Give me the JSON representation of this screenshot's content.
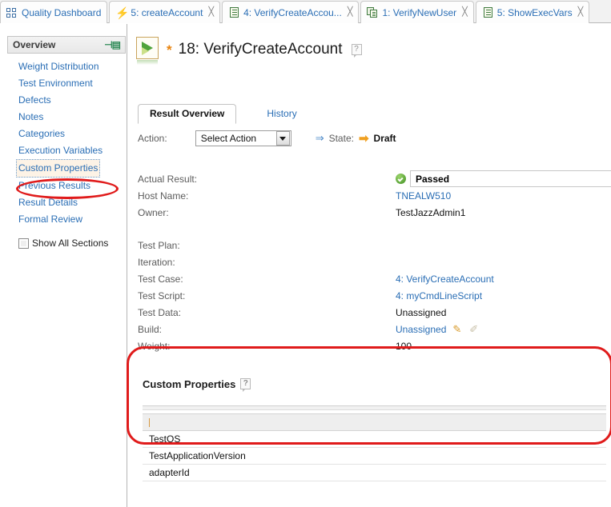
{
  "window": {
    "tabs": [
      {
        "label": "Quality Dashboard",
        "icon": "grid-icon",
        "closable": false
      },
      {
        "label": "5: createAccount",
        "icon": "lightning-icon",
        "closable": true
      },
      {
        "label": "4: VerifyCreateAccou...",
        "icon": "script-document-icon",
        "closable": true
      },
      {
        "label": "1: VerifyNewUser",
        "icon": "test-case-document-icon",
        "closable": true
      },
      {
        "label": "5: ShowExecVars",
        "icon": "script-document-icon",
        "closable": true
      }
    ],
    "close_glyph": "╳"
  },
  "sidebar": {
    "header": "Overview",
    "pin_glyph": "⊣▤",
    "items": [
      {
        "label": "Weight Distribution",
        "selected": false
      },
      {
        "label": "Test Environment",
        "selected": false
      },
      {
        "label": "Defects",
        "selected": false
      },
      {
        "label": "Notes",
        "selected": false
      },
      {
        "label": "Categories",
        "selected": false
      },
      {
        "label": "Execution Variables",
        "selected": false
      },
      {
        "label": "Custom Properties",
        "selected": true
      },
      {
        "label": "Previous Results",
        "selected": false
      },
      {
        "label": "Result Details",
        "selected": false
      },
      {
        "label": "Formal Review",
        "selected": false
      }
    ],
    "show_all_sections": {
      "label": "Show All Sections",
      "checked": false
    }
  },
  "page": {
    "dirty_marker": "*",
    "title": "18: VerifyCreateAccount",
    "help_glyph": "?",
    "icon": "run-test-icon"
  },
  "editor_tabs": [
    {
      "label": "Result Overview",
      "active": true
    },
    {
      "label": "History",
      "active": false
    }
  ],
  "action_bar": {
    "action_label": "Action:",
    "action_value": "Select Action",
    "state_label": "State:",
    "state_value": "Draft",
    "arrow_glyph": "⇒",
    "state_arrow_glyph": "➡"
  },
  "details": {
    "rows": [
      {
        "name": "Actual Result:",
        "value": "Passed",
        "style": "result"
      },
      {
        "name": "Host Name:",
        "value": "TNEALW510",
        "style": "link"
      },
      {
        "name": "Owner:",
        "value": "TestJazzAdmin1",
        "style": "plain"
      },
      {
        "name": "",
        "value": "",
        "style": "spacer"
      },
      {
        "name": "Test Plan:",
        "value": "",
        "style": "plain"
      },
      {
        "name": "Iteration:",
        "value": "",
        "style": "plain"
      },
      {
        "name": "Test Case:",
        "value": "4: VerifyCreateAccount",
        "style": "link"
      },
      {
        "name": "Test Script:",
        "value": "4: myCmdLineScript",
        "style": "link"
      },
      {
        "name": "Test Data:",
        "value": "Unassigned",
        "style": "plain"
      },
      {
        "name": "Build:",
        "value": "Unassigned",
        "style": "link-with-icons"
      },
      {
        "name": "Weight:",
        "value": "100",
        "style": "plain"
      }
    ],
    "build_edit_icon": "✎",
    "build_clear_icon": "✐"
  },
  "custom_properties": {
    "title": "Custom Properties",
    "help_glyph": "?",
    "filter_value": "",
    "rows": [
      {
        "name": "TestOS"
      },
      {
        "name": "TestApplicationVersion"
      },
      {
        "name": "adapterId"
      }
    ]
  },
  "annotations": {
    "highlight_color": "#e01b1b",
    "regions": [
      "sidebar-custom-properties",
      "custom-properties-section"
    ]
  }
}
